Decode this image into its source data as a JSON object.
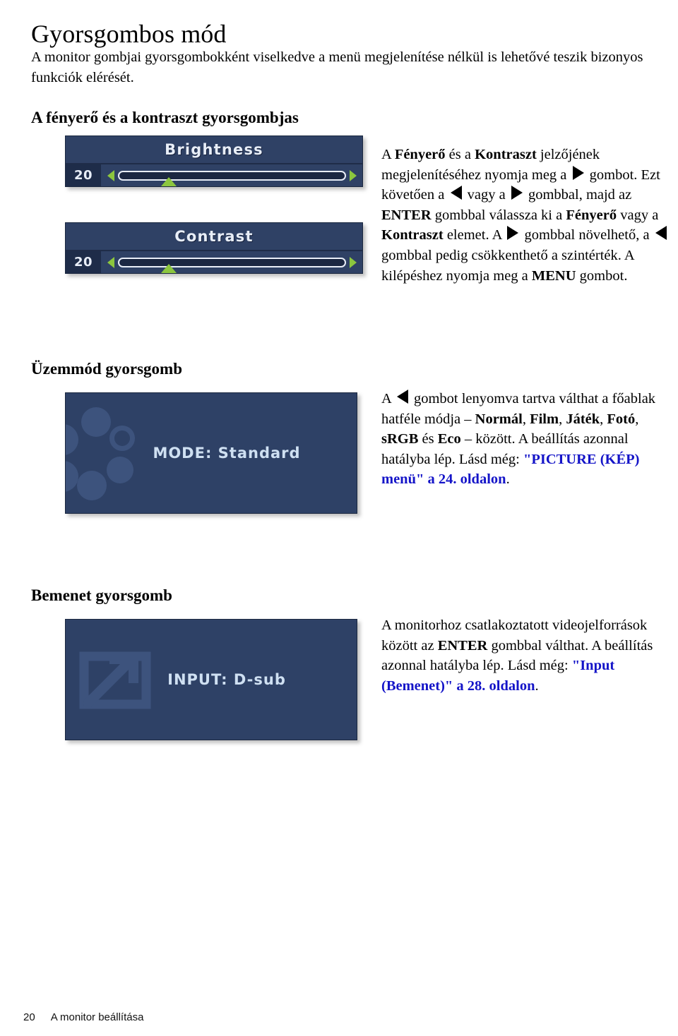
{
  "page": {
    "title": "Gyorsgombos mód",
    "intro": "A monitor gombjai gyorsgombokként viselkedve a menü megjelenítése nélkül is lehetővé teszik bizonyos funkciók elérését."
  },
  "sections": {
    "brightness_contrast": {
      "heading": "A fényerő és a kontraszt gyorsgombjas",
      "osd": [
        {
          "title": "Brightness",
          "value": "20",
          "thumb_percent": 22
        },
        {
          "title": "Contrast",
          "value": "20",
          "thumb_percent": 22
        }
      ],
      "text_parts": {
        "p1a": "A ",
        "b1": "Fényerő",
        "p1b": " és a ",
        "b2": "Kontraszt",
        "p1c": " jelzőjének megjelenítéséhez nyomja meg a ",
        "p1d": " gombot. Ezt követően a ",
        "p1e": " vagy a ",
        "p1f": " gombbal, majd az ",
        "b3": "ENTER",
        "p1g": " gombbal válassza ki a ",
        "b4": "Fényerő",
        "p1h": " vagy a ",
        "b5": "Kontraszt",
        "p1i": " elemet. A ",
        "p1j": " gombbal növelhető, a ",
        "p1k": " gombbal pedig csökkenthető a szintérték. A kilépéshez nyomja meg a ",
        "b6": "MENU",
        "p1l": " gombot."
      }
    },
    "mode": {
      "heading": "Üzemmód gyorsgomb",
      "osd": {
        "label": "MODE: Standard"
      },
      "text_parts": {
        "p1a": "A ",
        "p1b": " gombot lenyomva tartva válthat a főablak hatféle módja – ",
        "b1": "Normál",
        "s1": ", ",
        "b2": "Film",
        "s2": ", ",
        "b3": "Játék",
        "s3": ", ",
        "b4": "Fotó",
        "s4": ", ",
        "b5": "sRGB",
        "s5": " és ",
        "b6": "Eco",
        "p1c": " – között. A beállítás azonnal hatályba lép. Lásd még: ",
        "link": "\"PICTURE (KÉP) menü\" a 24. oldalon",
        "p1d": "."
      }
    },
    "input": {
      "heading": "Bemenet gyorsgomb",
      "osd": {
        "label": "INPUT: D-sub"
      },
      "text_parts": {
        "p1a": "A monitorhoz csatlakoztatott videojelforrások között az ",
        "b1": "ENTER",
        "p1b": " gombbal válthat. A beállítás azonnal hatályba lép. Lásd még: ",
        "link": "\"Input (Bemenet)\" a 28. oldalon",
        "p1c": "."
      }
    }
  },
  "footer": {
    "page_number": "20",
    "section_name": "A monitor beállítása"
  },
  "colors": {
    "osd_background": "#2e4166",
    "osd_value_box": "#1e2c49",
    "osd_text": "#e8eef8",
    "accent_green": "#8cc63e",
    "link_blue": "#1414c8",
    "deco_circle": "#3d537d"
  }
}
